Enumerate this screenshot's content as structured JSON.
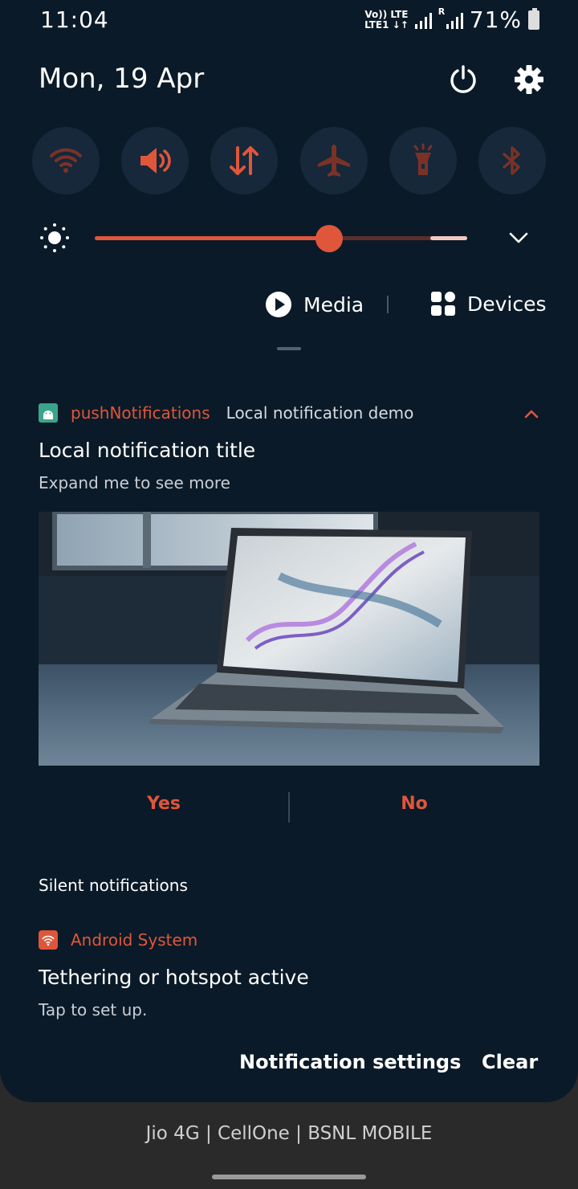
{
  "status_bar": {
    "time": "11:04",
    "net_top": "Vo)) LTE",
    "net_bottom": "LTE1 ↓↑",
    "roaming_mark": "R",
    "battery": "71%"
  },
  "header": {
    "date": "Mon, 19 Apr",
    "power_icon": "power-icon",
    "settings_icon": "gear-icon"
  },
  "quick_settings": [
    {
      "name": "wifi",
      "icon": "wifi-icon"
    },
    {
      "name": "sound",
      "icon": "speaker-icon"
    },
    {
      "name": "mobile-data",
      "icon": "data-arrows-icon"
    },
    {
      "name": "airplane",
      "icon": "airplane-icon"
    },
    {
      "name": "flashlight",
      "icon": "flashlight-icon"
    },
    {
      "name": "bluetooth",
      "icon": "bluetooth-icon"
    }
  ],
  "brightness": {
    "level": 0.63
  },
  "media_row": {
    "media_label": "Media",
    "devices_label": "Devices"
  },
  "notification": {
    "app_name": "pushNotifications",
    "subtitle": "Local notification demo",
    "title": "Local notification title",
    "text": "Expand me to see more",
    "actions": {
      "yes": "Yes",
      "no": "No"
    }
  },
  "silent": {
    "section_label": "Silent notifications",
    "app_name": "Android System",
    "title": "Tethering or hotspot active",
    "text": "Tap to set up."
  },
  "footer": {
    "settings_label": "Notification settings",
    "clear_label": "Clear"
  },
  "carrier": "Jio 4G | CellOne | BSNL MOBILE",
  "colors": {
    "accent": "#e0563a",
    "panel": "#0b1a28",
    "tile": "#16283a"
  }
}
